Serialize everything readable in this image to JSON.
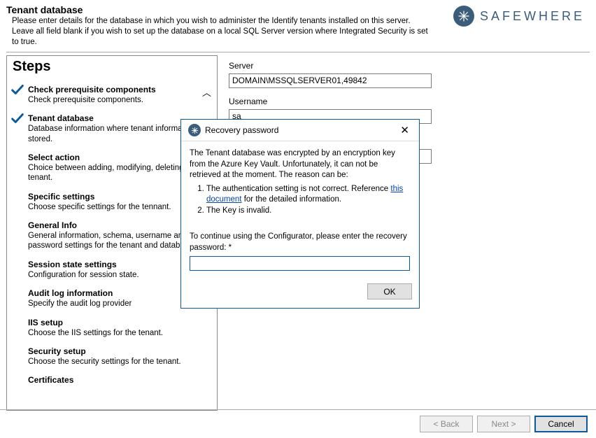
{
  "header": {
    "title": "Tenant database",
    "description": "Please enter details for the database in which you wish to administer the Identify tenants installed on this server. Leave all field blank if you wish to set up the database on a local SQL Server version where Integrated Security is set to true."
  },
  "brand": {
    "name": "SAFEWHERE"
  },
  "steps": {
    "title": "Steps",
    "items": [
      {
        "title": "Check prerequisite components",
        "desc": "Check prerequisite components.",
        "checked": true
      },
      {
        "title": "Tenant database",
        "desc": "Database information where tenant information stored.",
        "checked": true
      },
      {
        "title": "Select action",
        "desc": "Choice between adding, modifying, deleting a tenant.",
        "checked": false
      },
      {
        "title": "Specific settings",
        "desc": "Choose specific settings for the tennant.",
        "checked": false
      },
      {
        "title": "General Info",
        "desc": "General information, schema, username and password settings for the tenant and database.",
        "checked": false
      },
      {
        "title": "Session state settings",
        "desc": "Configuration for session state.",
        "checked": false
      },
      {
        "title": "Audit log information",
        "desc": "Specify the audit log provider",
        "checked": false
      },
      {
        "title": "IIS setup",
        "desc": "Choose the IIS settings for the tenant.",
        "checked": false
      },
      {
        "title": "Security setup",
        "desc": "Choose the security settings for the tenant.",
        "checked": false
      },
      {
        "title": "Certificates",
        "desc": "",
        "checked": false
      }
    ]
  },
  "form": {
    "server_label": "Server",
    "server_value": "DOMAIN\\MSSQLSERVER01,49842",
    "username_label": "Username",
    "username_value": "sa"
  },
  "dialog": {
    "title": "Recovery password",
    "intro": "The Tenant database was encrypted by an encryption key from the Azure Key Vault. Unfortunately, it can not be retrieved at the moment. The reason can be:",
    "reason1_prefix": "The authentication setting is not correct. Reference ",
    "reason1_link": "this document",
    "reason1_suffix": " for the detailed information.",
    "reason2": "The Key is invalid.",
    "continue": "To continue using the Configurator, please enter the recovery password: *",
    "ok": "OK"
  },
  "footer": {
    "back": "< Back",
    "next": "Next >",
    "cancel": "Cancel"
  }
}
